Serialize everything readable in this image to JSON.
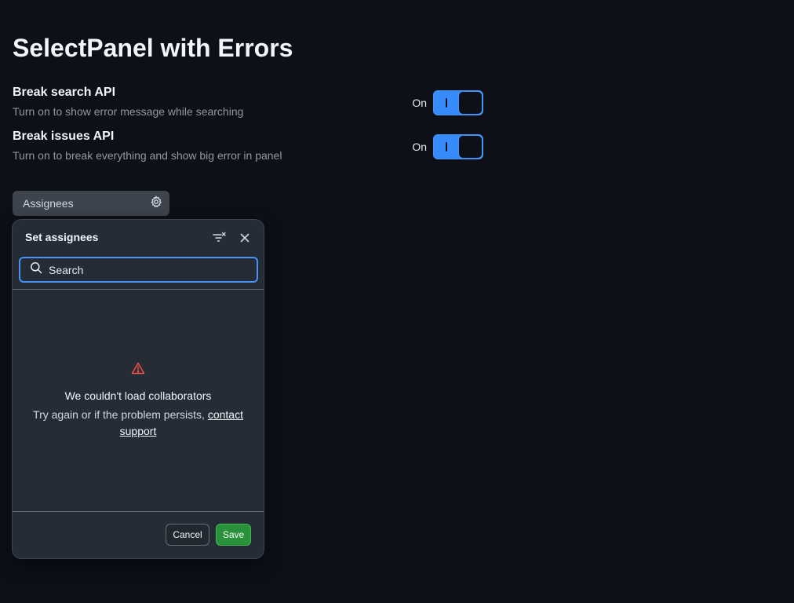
{
  "page": {
    "title": "SelectPanel with Errors"
  },
  "settings": [
    {
      "title": "Break search API",
      "description": "Turn on to show error message while searching",
      "state_label": "On"
    },
    {
      "title": "Break issues API",
      "description": "Turn on to break everything and show big error in panel",
      "state_label": "On"
    }
  ],
  "assignees_button": {
    "label": "Assignees",
    "icon": "gear-icon"
  },
  "panel": {
    "title": "Set assignees",
    "header_icons": [
      "filter-remove-icon",
      "close-icon"
    ],
    "search": {
      "placeholder": "Search",
      "value": ""
    },
    "error": {
      "icon": "alert-icon",
      "title": "We couldn't load collaborators",
      "description": "Try again or if the problem persists,",
      "link_text": "contact support"
    },
    "footer": {
      "cancel_label": "Cancel",
      "save_label": "Save"
    }
  },
  "colors": {
    "background": "#0d1117",
    "accent": "#4493f8",
    "danger": "#f85149",
    "success": "#29903b"
  }
}
